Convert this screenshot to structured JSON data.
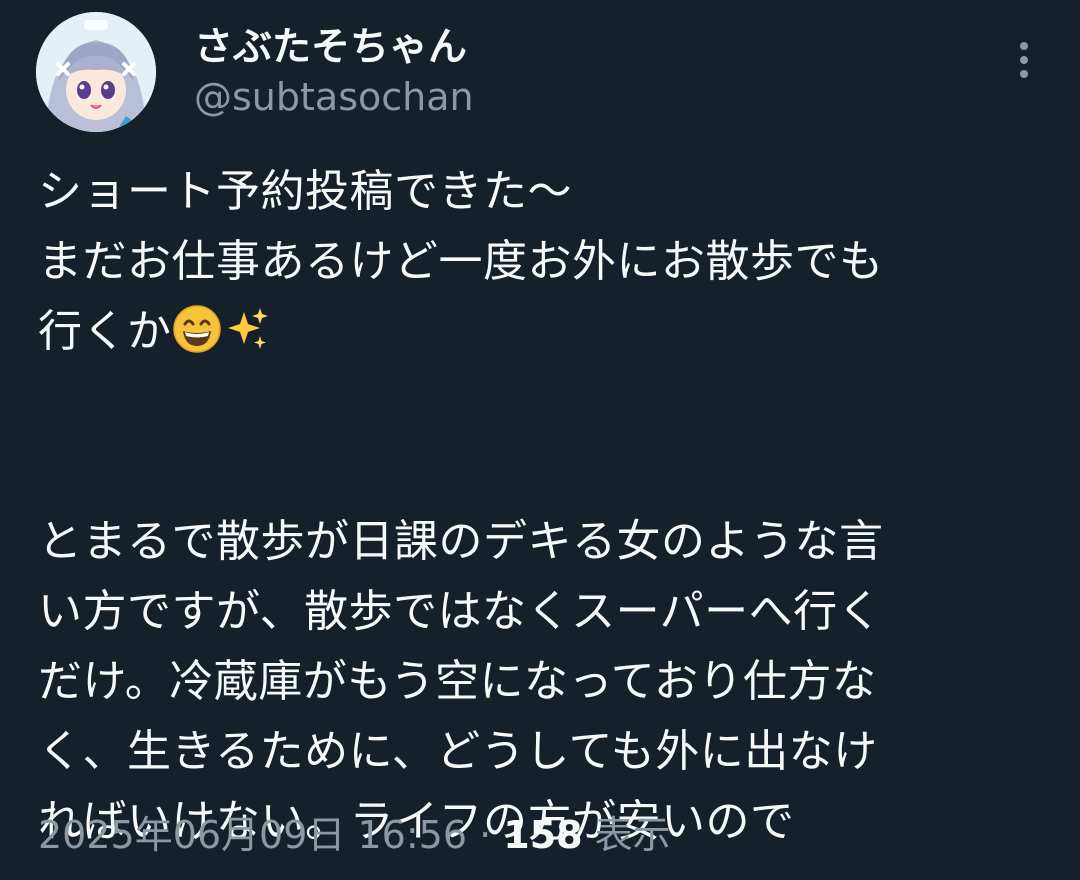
{
  "author": {
    "display_name": "さぶたそちゃん",
    "handle": "@subtasochan",
    "avatar_icon": "anime-avatar"
  },
  "menu": {
    "icon": "more-vertical-icon"
  },
  "tweet": {
    "lines": [
      "ショート予約投稿できた〜",
      "まだお仕事あるけど一度お外にお散歩でも",
      "行くか"
    ],
    "emojis": [
      "grinning-face-icon",
      "sparkles-icon"
    ],
    "paragraph2": [
      "とまるで散歩が日課のデキる女のような言",
      "い方ですが、散歩ではなくスーパーへ行く",
      "だけ。冷蔵庫がもう空になっており仕方な",
      "く、生きるために、どうしても外に出なけ",
      "ればいけない。ライフの方が安いので"
    ]
  },
  "meta": {
    "timestamp": "2025年06月09日 16:56",
    "separator": " · ",
    "views_count": "158",
    "views_label": " 表示"
  },
  "colors": {
    "background": "#15202b",
    "text_primary": "#f7f9f9",
    "text_secondary": "#8b98a5"
  }
}
